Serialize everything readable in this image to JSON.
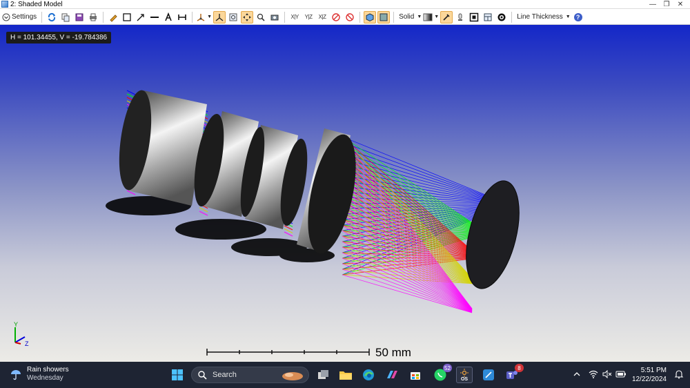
{
  "window": {
    "title": "2: Shaded Model",
    "controls": {
      "minimize": "—",
      "restore": "❐",
      "close": "✕"
    }
  },
  "toolbar": {
    "settings_label": "Settings",
    "draw_mode_label": "Solid",
    "line_thickness_label": "Line Thickness",
    "axis_buttons": [
      "X|Y",
      "Y|Z",
      "X|Z"
    ],
    "help_label": "?"
  },
  "viewport": {
    "coord_readout": "H = 101.34455, V = -19.784386",
    "scale_bar_label": "50 mm",
    "axis_triad": {
      "y": "Y",
      "z": "Z"
    },
    "ray_colors": [
      "#0000ff",
      "#00ff00",
      "#ff0000",
      "#d4d400",
      "#ff00ff"
    ]
  },
  "taskbar": {
    "weather_title": "Rain showers",
    "weather_sub": "Wednesday",
    "search_label": "Search",
    "whatsapp_badge": "52",
    "teams_badge": "8",
    "time": "5:51 PM",
    "date": "12/22/2024",
    "os_app_label": "OS"
  }
}
